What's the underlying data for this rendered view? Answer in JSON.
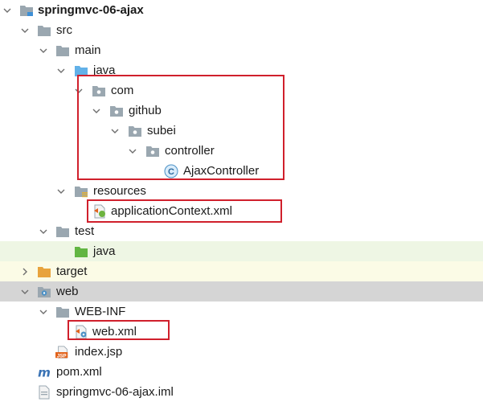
{
  "project_tree": {
    "items": [
      {
        "label": "springmvc-06-ajax",
        "icon": "module-folder-icon",
        "expanded": true
      },
      {
        "label": "src",
        "icon": "folder-icon",
        "expanded": true
      },
      {
        "label": "main",
        "icon": "folder-icon",
        "expanded": true
      },
      {
        "label": "java",
        "icon": "source-root-folder-icon",
        "expanded": true
      },
      {
        "label": "com",
        "icon": "package-icon",
        "expanded": true
      },
      {
        "label": "github",
        "icon": "package-icon",
        "expanded": true
      },
      {
        "label": "subei",
        "icon": "package-icon",
        "expanded": true
      },
      {
        "label": "controller",
        "icon": "package-icon",
        "expanded": true
      },
      {
        "label": "AjaxController",
        "icon": "java-class-icon"
      },
      {
        "label": "resources",
        "icon": "resources-folder-icon",
        "expanded": true
      },
      {
        "label": "applicationContext.xml",
        "icon": "spring-xml-file-icon"
      },
      {
        "label": "test",
        "icon": "folder-icon",
        "expanded": true
      },
      {
        "label": "java",
        "icon": "test-source-folder-icon"
      },
      {
        "label": "target",
        "icon": "excluded-folder-icon",
        "expanded": false
      },
      {
        "label": "web",
        "icon": "web-folder-icon",
        "expanded": true
      },
      {
        "label": "WEB-INF",
        "icon": "folder-icon",
        "expanded": true
      },
      {
        "label": "web.xml",
        "icon": "web-xml-file-icon"
      },
      {
        "label": "index.jsp",
        "icon": "jsp-file-icon"
      },
      {
        "label": "pom.xml",
        "icon": "maven-pom-icon"
      },
      {
        "label": "springmvc-06-ajax.iml",
        "icon": "iml-file-icon"
      }
    ],
    "jsp_badge": "JSP",
    "class_badge": "C",
    "pom_badge": "m"
  },
  "colors": {
    "folder": "#9aa7b0",
    "source_folder": "#62b1e8",
    "test_folder": "#62b543",
    "excluded_folder": "#e8a33d",
    "highlight_box": "#d0202c",
    "selection": "#d5d5d5"
  }
}
